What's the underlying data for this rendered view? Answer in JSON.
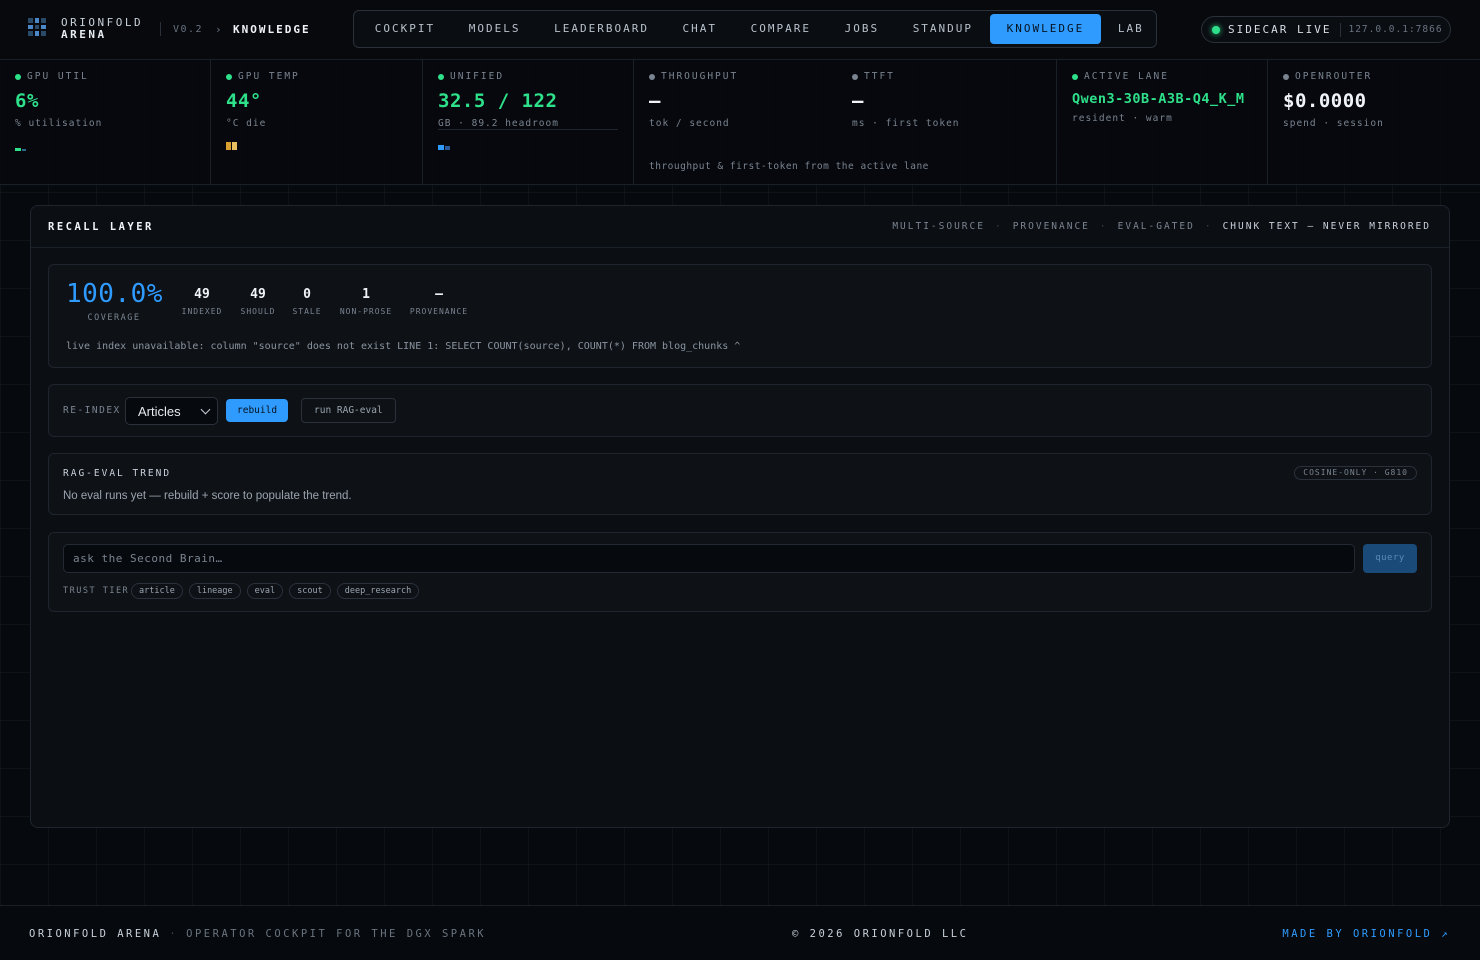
{
  "header": {
    "brand_line1": "ORIONFOLD",
    "brand_line2": "ARENA",
    "version": "V0.2",
    "crumb_sep": "›",
    "crumb": "KNOWLEDGE",
    "nav": [
      {
        "label": "COCKPIT",
        "active": false
      },
      {
        "label": "MODELS",
        "active": false
      },
      {
        "label": "LEADERBOARD",
        "active": false
      },
      {
        "label": "CHAT",
        "active": false
      },
      {
        "label": "COMPARE",
        "active": false
      },
      {
        "label": "JOBS",
        "active": false
      },
      {
        "label": "STANDUP",
        "active": false
      },
      {
        "label": "KNOWLEDGE",
        "active": true
      },
      {
        "label": "LAB",
        "active": false
      }
    ],
    "sidecar_label": "SIDECAR LIVE",
    "sidecar_addr": "127.0.0.1:7866"
  },
  "metrics": {
    "gpu_util": {
      "label": "GPU UTIL",
      "value": "6%",
      "sub": "% utilisation",
      "level": 6
    },
    "gpu_temp": {
      "label": "GPU TEMP",
      "value": "44°",
      "sub": "°C die"
    },
    "unified": {
      "label": "UNIFIED",
      "value": "32.5 / 122",
      "sub": "GB · 89.2 headroom"
    },
    "throughput": {
      "label": "THROUGHPUT",
      "value": "—",
      "sub": "tok / second"
    },
    "ttft": {
      "label": "TTFT",
      "value": "—",
      "sub": "ms · first token"
    },
    "throughput_note": "throughput & first-token from the active lane",
    "active_lane": {
      "label": "ACTIVE LANE",
      "value": "Qwen3-30B-A3B-Q4_K_M",
      "sub": "resident · warm"
    },
    "openrouter": {
      "label": "OPENROUTER",
      "value": "$0.0000",
      "sub": "spend · session"
    }
  },
  "panel": {
    "title": "RECALL LAYER",
    "tags": [
      "MULTI-SOURCE",
      "PROVENANCE",
      "EVAL-GATED"
    ],
    "tag_highlight": "CHUNK TEXT — NEVER MIRRORED",
    "coverage": {
      "value": "100.0%",
      "label": "COVERAGE"
    },
    "stats": [
      {
        "value": "49",
        "label": "INDEXED"
      },
      {
        "value": "49",
        "label": "SHOULD"
      },
      {
        "value": "0",
        "label": "STALE"
      },
      {
        "value": "1",
        "label": "NON-PROSE"
      },
      {
        "value": "—",
        "label": "PROVENANCE"
      }
    ],
    "error": "live index unavailable: column \"source\" does not exist LINE 1: SELECT COUNT(source), COUNT(*) FROM blog_chunks ^",
    "reindex": {
      "label": "RE-INDEX",
      "select_value": "Articles",
      "rebuild": "rebuild",
      "run_eval": "run RAG-eval"
    },
    "trend": {
      "title": "RAG-EVAL TREND",
      "pill": "COSINE-ONLY · G810",
      "message": "No eval runs yet — rebuild + score to populate the trend."
    },
    "query": {
      "placeholder": "ask the Second Brain…",
      "button": "query",
      "tier_label": "TRUST TIER",
      "tiers": [
        "article",
        "lineage",
        "eval",
        "scout",
        "deep_research"
      ]
    }
  },
  "footer": {
    "brand": "ORIONFOLD ARENA",
    "tagline": "OPERATOR COCKPIT FOR THE DGX SPARK",
    "copyright": "© 2026 ORIONFOLD LLC",
    "made_by": "MADE BY ORIONFOLD ↗"
  },
  "colors": {
    "accent": "#2f9bff",
    "status_green": "#2ee08a",
    "background": "#06090d"
  }
}
